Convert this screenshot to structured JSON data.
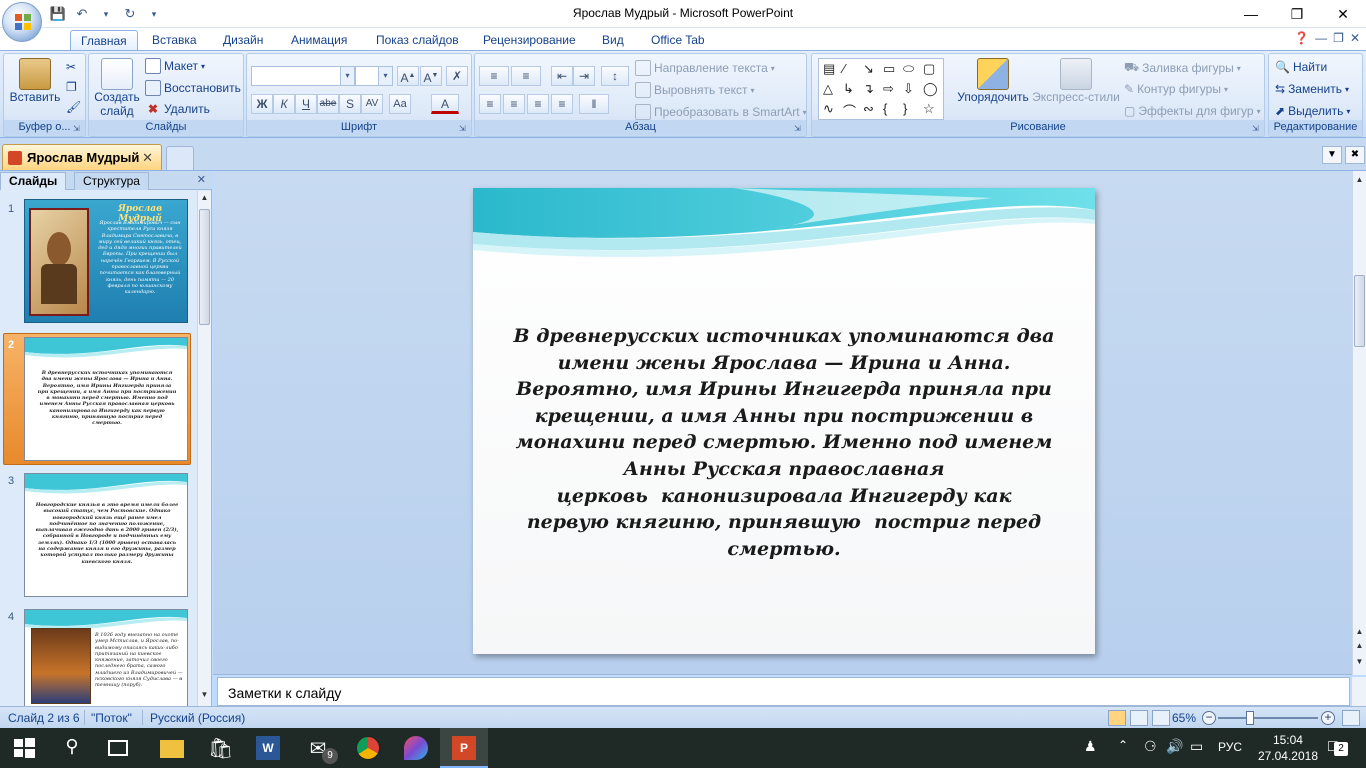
{
  "titlebar": {
    "title": "Ярослав Мудрый - Microsoft PowerPoint"
  },
  "ribbon_tabs": [
    "Главная",
    "Вставка",
    "Дизайн",
    "Анимация",
    "Показ слайдов",
    "Рецензирование",
    "Вид",
    "Office Tab"
  ],
  "ribbon": {
    "clipboard": {
      "paste": "Вставить",
      "label": "Буфер о..."
    },
    "slides": {
      "create": "Создать",
      "create2": "слайд",
      "layout": "Макет",
      "reset": "Восстановить",
      "delete": "Удалить",
      "label": "Слайды"
    },
    "font": {
      "label": "Шрифт",
      "bold": "Ж",
      "italic": "К",
      "underline": "Ч",
      "strike": "abe",
      "shadow": "S",
      "spacing": "AV",
      "case": "Аа",
      "color": "A"
    },
    "paragraph": {
      "direction": "Направление текста",
      "align": "Выровнять текст",
      "smartart": "Преобразовать в SmartArt",
      "label": "Абзац"
    },
    "drawing": {
      "arrange": "Упорядочить",
      "quickstyles": "Экспресс-стили",
      "fill": "Заливка фигуры",
      "outline": "Контур фигуры",
      "effects": "Эффекты для фигур",
      "label": "Рисование"
    },
    "editing": {
      "find": "Найти",
      "replace": "Заменить",
      "select": "Выделить",
      "label": "Редактирование"
    }
  },
  "doc_tab": {
    "title": "Ярослав Мудрый"
  },
  "panel": {
    "tab_slides": "Слайды",
    "tab_outline": "Структура",
    "thumbs": [
      {
        "num": "1",
        "title": "Ярослав Мудрый",
        "text": "Ярослав Владимирович — сын крестителя Руси князя Владимира Святославича, в миру сей великий князь, отец, дед и дядя многих правителей Европы. При крещении был наречён Георгием. В Русской православной церкви почитается как благоверный князь, день памяти — 20 февраля по юлианскому календарю."
      },
      {
        "num": "2",
        "text": "В древнерусских источниках упоминаются два имени жены Ярослава — Ирина и Анна. Вероятно, имя Ирины Ингигерда приняла при крещении, а имя Анны при пострижении в монахини перед смертью. Именно под именем Анны Русская православная церковь канонизировала Ингигерду как первую княгиню, принявшую постриг перед смертью."
      },
      {
        "num": "3",
        "text": "Новгородские князья в это время имели более высокий статус, чем Ростовские. Однако новгородский князь ещё ранее имел подчинённое по значению положение, выплачивая ежегодно дань в 2000 гривен (2/3), собранной в Новгороде и подчинённых ему землях). Однако 1/3 (1000 гривен) оставалась на содержание князя и его дружины, размер которой уступал только размеру дружины киевского князя."
      },
      {
        "num": "4",
        "text": "В 1036 году внезапно на охоте умер Мстислав, и Ярослав, по-видимому опасаясь каких-либо притязаний на киевское княжение, заточил своего последнего брата, самого младшего из Владимировичей — псковского князя Судислава — в темницу (поруб)."
      }
    ]
  },
  "slide": {
    "lines": [
      "В древнерусских источниках упоминаются два",
      "имени жены Ярослава — Ирина и Анна.",
      "Вероятно, имя Ирины Ингигерда приняла при",
      "крещении, а имя Анны при пострижении в",
      "монахини перед смертью. Именно под именем",
      "Анны Русская православная",
      "церковь  канонизировала Ингигерду как",
      "первую княгиню, принявшую  постриг перед",
      "смертью."
    ]
  },
  "notes": {
    "placeholder": "Заметки к слайду"
  },
  "status": {
    "slide": "Слайд 2 из 6",
    "theme": "\"Поток\"",
    "lang": "Русский (Россия)",
    "zoom": "65%",
    "zoom_level": 0.65
  },
  "taskbar": {
    "lang": "РУС",
    "time": "15:04",
    "date": "27.04.2018",
    "mail_badge": "9",
    "notif_badge": "2"
  },
  "colors": {
    "accent": "#15428b",
    "ribbon": "#dce8f8",
    "slide_wave": "#3ec6d6"
  }
}
